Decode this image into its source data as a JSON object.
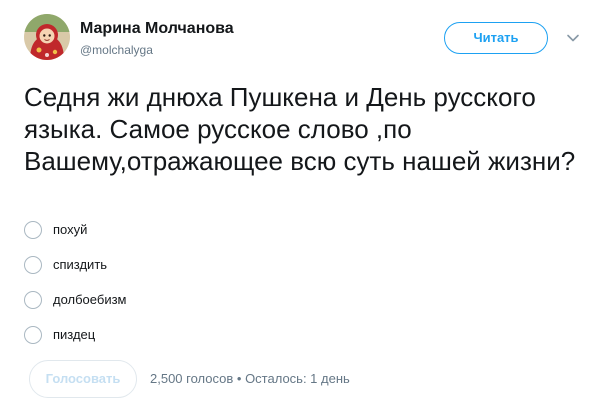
{
  "author": {
    "name": "Марина Молчанова",
    "handle": "@molchalyga",
    "avatar_icon": "masha-cartoon-avatar"
  },
  "header": {
    "follow_label": "Читать",
    "more_icon": "chevron-down-icon"
  },
  "tweet": {
    "text": "Седня жи днюха Пушкена и День русского языка. Самое русское слово ,по Вашему,отражающее всю суть нашей жизни?"
  },
  "poll": {
    "options": [
      {
        "label": "похуй"
      },
      {
        "label": "спиздить"
      },
      {
        "label": "долбоебизм"
      },
      {
        "label": "пиздец"
      }
    ],
    "vote_label": "Голосовать",
    "meta": "2,500 голосов • Осталось: 1 день"
  },
  "colors": {
    "accent": "#1da1f2",
    "text": "#14171a",
    "secondary_text": "#657786",
    "radio_border": "#aab8c2",
    "disabled_button_text": "#c5dff2"
  }
}
